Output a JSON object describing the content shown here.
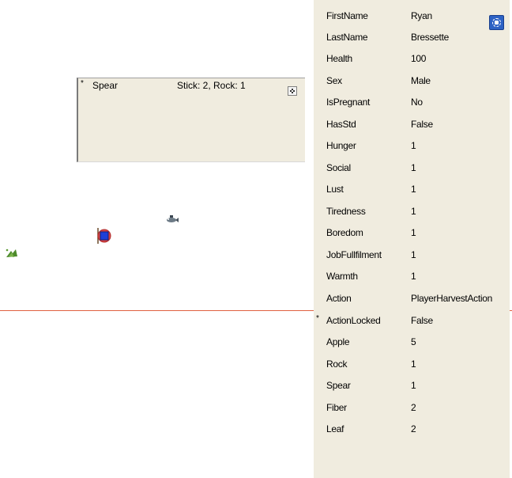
{
  "craft_panel": {
    "items": [
      {
        "marker": "*",
        "name": "Spear",
        "requirements": "Stick: 2, Rock: 1"
      }
    ],
    "close_icon": "close-icon"
  },
  "sprites": {
    "fish": "fish-icon",
    "player": "player-marker-icon",
    "plant": "plant-icon"
  },
  "properties": {
    "settings_icon": "gear-icon",
    "rows": [
      {
        "marker": "",
        "key": "FirstName",
        "value": "Ryan"
      },
      {
        "marker": "",
        "key": "LastName",
        "value": "Bressette"
      },
      {
        "marker": "",
        "key": "Health",
        "value": "100"
      },
      {
        "marker": "",
        "key": "Sex",
        "value": "Male"
      },
      {
        "marker": "",
        "key": "IsPregnant",
        "value": "No"
      },
      {
        "marker": "",
        "key": "HasStd",
        "value": "False"
      },
      {
        "marker": "",
        "key": "Hunger",
        "value": "1"
      },
      {
        "marker": "",
        "key": "Social",
        "value": "1"
      },
      {
        "marker": "",
        "key": "Lust",
        "value": "1"
      },
      {
        "marker": "",
        "key": "Tiredness",
        "value": "1"
      },
      {
        "marker": "",
        "key": "Boredom",
        "value": "1"
      },
      {
        "marker": "",
        "key": "JobFullfilment",
        "value": "1"
      },
      {
        "marker": "",
        "key": "Warmth",
        "value": "1"
      },
      {
        "marker": "",
        "key": "Action",
        "value": "PlayerHarvestAction"
      },
      {
        "marker": "*",
        "key": "ActionLocked",
        "value": "False"
      },
      {
        "marker": "",
        "key": "Apple",
        "value": "5"
      },
      {
        "marker": "",
        "key": "Rock",
        "value": "1"
      },
      {
        "marker": "",
        "key": "Spear",
        "value": "1"
      },
      {
        "marker": "",
        "key": "Fiber",
        "value": "2"
      },
      {
        "marker": "",
        "key": "Leaf",
        "value": "2"
      }
    ]
  }
}
